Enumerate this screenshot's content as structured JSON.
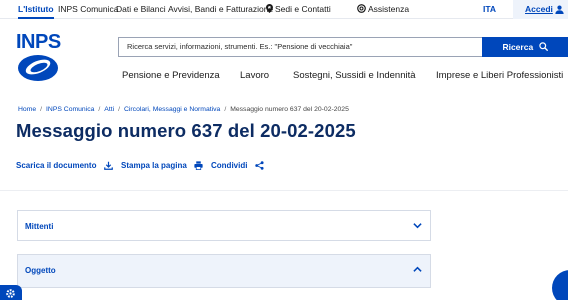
{
  "topbar": {
    "links": [
      "L'Istituto",
      "INPS Comunica",
      "Dati e Bilanci",
      "Avvisi, Bandi e Fatturazione",
      "Sedi e Contatti",
      "Assistenza"
    ],
    "lang": "ITA",
    "login": "Accedi"
  },
  "header": {
    "logo_text": "INPS",
    "search_placeholder": "Ricerca servizi, informazioni, strumenti. Es.: \"Pensione di vecchiaia\"",
    "search_button": "Ricerca"
  },
  "nav": [
    "Pensione e Previdenza",
    "Lavoro",
    "Sostegni, Sussidi e Indennità",
    "Imprese e Liberi Professionisti"
  ],
  "breadcrumb": [
    "Home",
    "INPS Comunica",
    "Atti",
    "Circolari, Messaggi e Normativa",
    "Messaggio numero 637 del 20-02-2025"
  ],
  "page": {
    "title": "Messaggio numero 637 del 20-02-2025",
    "actions": {
      "download": "Scarica il documento",
      "print": "Stampa la pagina",
      "share": "Condividi"
    }
  },
  "accordion": [
    {
      "label": "Mittenti",
      "expanded": false
    },
    {
      "label": "Oggetto",
      "expanded": true
    }
  ],
  "colors": {
    "primary": "#0047bb",
    "title": "#0d2c63",
    "accordion_open_bg": "#eef3fb"
  },
  "icons": [
    "map-pin-icon",
    "lifebuoy-icon",
    "user-icon",
    "search-icon",
    "download-icon",
    "print-icon",
    "share-icon",
    "chevron-down-icon",
    "chevron-up-icon",
    "settings-icon"
  ]
}
